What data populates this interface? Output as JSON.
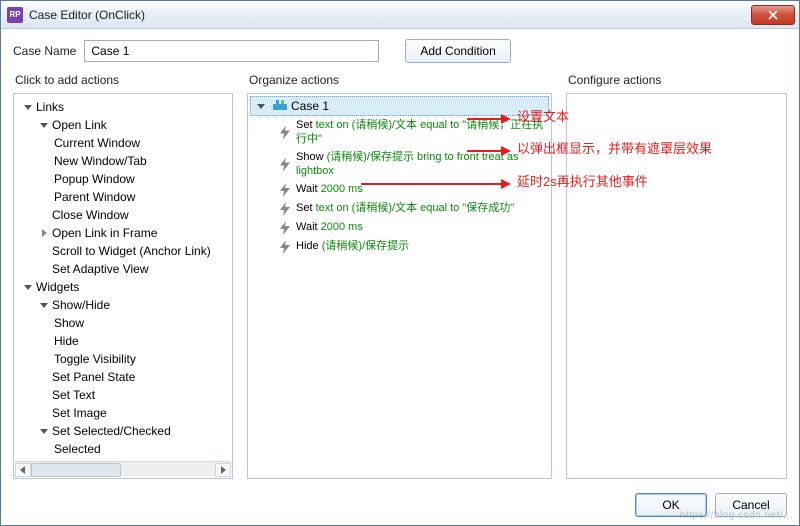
{
  "window": {
    "title": "Case Editor (OnClick)"
  },
  "caseName": {
    "label": "Case Name",
    "value": "Case 1"
  },
  "addCondition": {
    "label": "Add Condition"
  },
  "headers": {
    "left": "Click to add actions",
    "mid": "Organize actions",
    "right": "Configure actions"
  },
  "leftTree": {
    "links": "Links",
    "openLink": "Open Link",
    "currentWindow": "Current Window",
    "newWindowTab": "New Window/Tab",
    "popupWindow": "Popup Window",
    "parentWindow": "Parent Window",
    "closeWindow": "Close Window",
    "openLinkInFrame": "Open Link in Frame",
    "scrollToWidget": "Scroll to Widget (Anchor Link)",
    "setAdaptiveView": "Set Adaptive View",
    "widgets": "Widgets",
    "showHide": "Show/Hide",
    "show": "Show",
    "hide": "Hide",
    "toggleVisibility": "Toggle Visibility",
    "setPanelState": "Set Panel State",
    "setText": "Set Text",
    "setImage": "Set Image",
    "setSelectedChecked": "Set Selected/Checked",
    "selected": "Selected"
  },
  "case": {
    "label": "Case 1"
  },
  "actions": {
    "a1_black1": "Set ",
    "a1_green1": "text on (请稍候)/文本 equal to \"请稍候，正在执行中\"",
    "a2_black1": "Show ",
    "a2_green1": "(请稍候)/保存提示 bring to front treat as lightbox",
    "a3_black1": "Wait ",
    "a3_green1": "2000 ms",
    "a4_black1": "Set ",
    "a4_green1": "text on (请稍候)/文本 equal to \"保存成功\"",
    "a5_black1": "Wait ",
    "a5_green1": "2000 ms",
    "a6_black1": "Hide ",
    "a6_green1": "(请稍候)/保存提示"
  },
  "annotations": {
    "r1": "设置文本",
    "r2": "以弹出框显示，并带有遮罩层效果",
    "r3": "延时2s再执行其他事件"
  },
  "buttons": {
    "ok": "OK",
    "cancel": "Cancel"
  },
  "watermark": "https://blog.csdn.net/..."
}
